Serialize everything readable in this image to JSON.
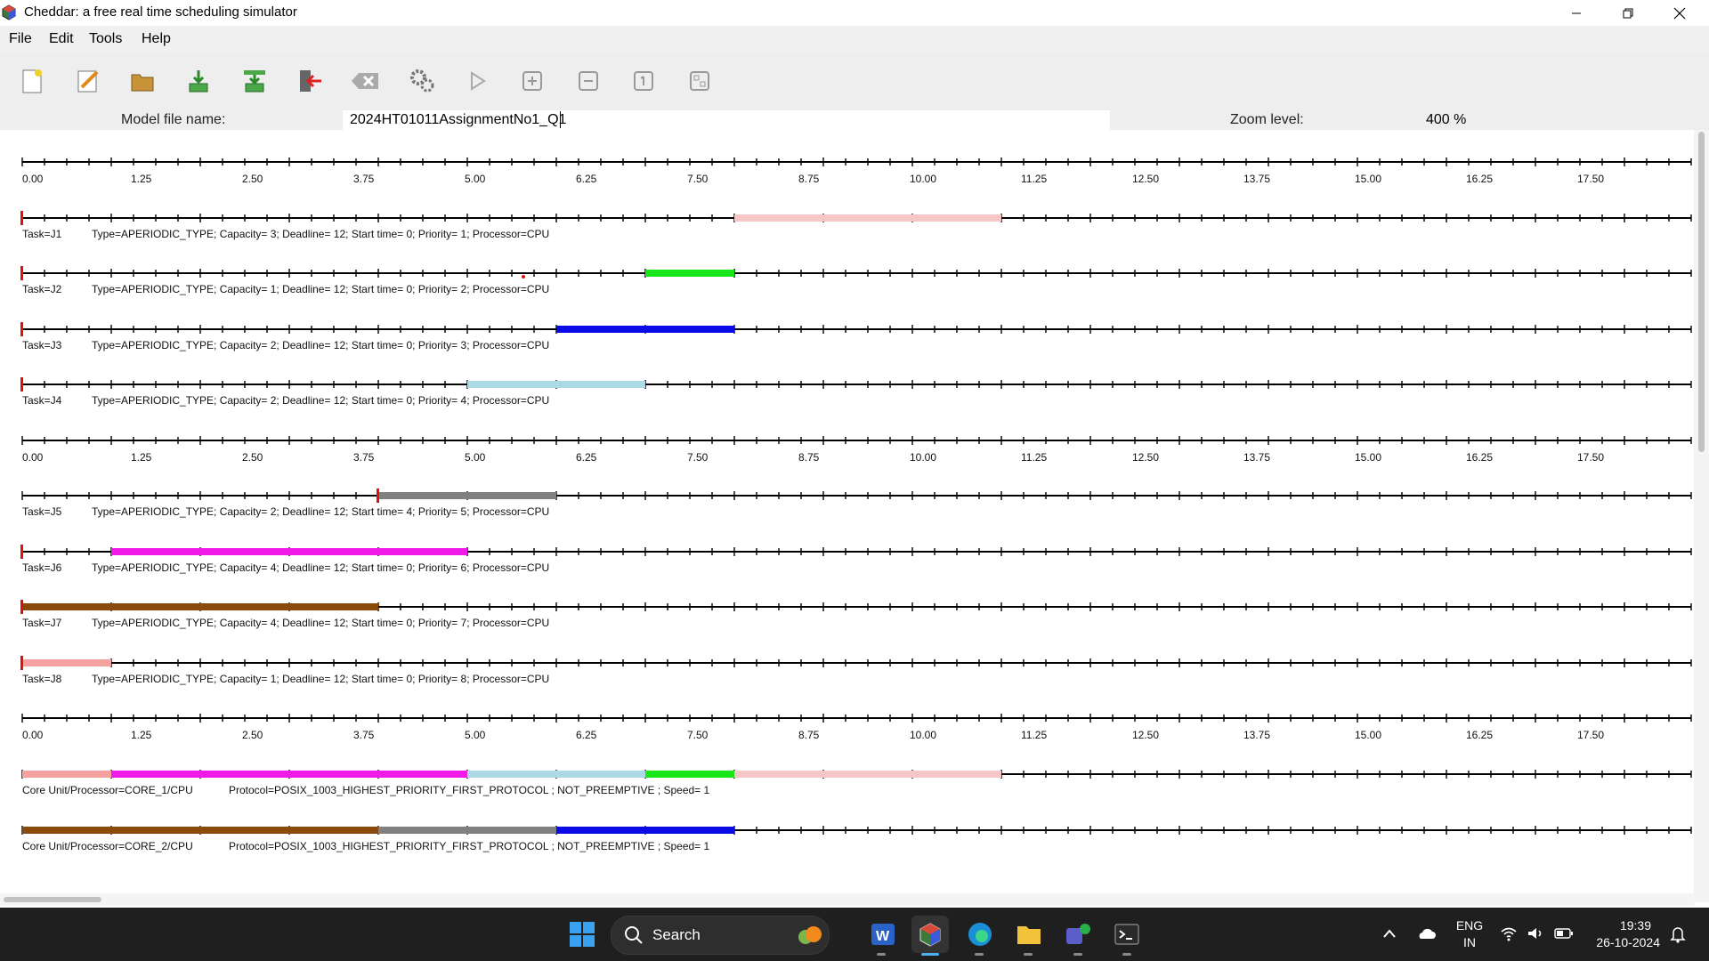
{
  "window": {
    "title": "Cheddar: a free real time scheduling simulator",
    "controls": [
      "minimize",
      "restore",
      "close"
    ]
  },
  "menu": [
    "File",
    "Edit",
    "Tools",
    "Help"
  ],
  "toolbar": {
    "icons": [
      "new-file-icon",
      "edit-icon",
      "open-folder-icon",
      "save-icon",
      "export-icon",
      "exit-icon",
      "clear-icon",
      "settings-icon",
      "play-icon",
      "zoom-in-icon",
      "zoom-out-icon",
      "zoom-reset-icon",
      "fit-icon"
    ]
  },
  "file_info": {
    "model_label": "Model file name:",
    "model_value": "2024HT01011AssignmentNo1_Q1",
    "zoom_label": "Zoom level:",
    "zoom_value": "400 %"
  },
  "gantt": {
    "tick_labels": [
      "0.00",
      "1.25",
      "2.50",
      "3.75",
      "5.00",
      "6.25",
      "7.50",
      "8.75",
      "10.00",
      "11.25",
      "12.50",
      "13.75",
      "15.00",
      "16.25",
      "17.50"
    ],
    "tasks": [
      {
        "name": "Task=J1",
        "details": "Type=APERIODIC_TYPE; Capacity= 3; Deadline= 12; Start time= 0; Priority= 1; Processor=CPU",
        "release": 0,
        "color": "#f7c6c6",
        "segments": [
          [
            8,
            11
          ]
        ]
      },
      {
        "name": "Task=J2",
        "details": "Type=APERIODIC_TYPE; Capacity= 1; Deadline= 12; Start time= 0; Priority= 2; Processor=CPU",
        "release": 0,
        "color": "#19e619",
        "segments": [
          [
            7,
            8
          ]
        ]
      },
      {
        "name": "Task=J3",
        "details": "Type=APERIODIC_TYPE; Capacity= 2; Deadline= 12; Start time= 0; Priority= 3; Processor=CPU",
        "release": 0,
        "color": "#0a0ae6",
        "segments": [
          [
            6,
            8
          ]
        ]
      },
      {
        "name": "Task=J4",
        "details": "Type=APERIODIC_TYPE; Capacity= 2; Deadline= 12; Start time= 0; Priority= 4; Processor=CPU",
        "release": 0,
        "color": "#add8e6",
        "segments": [
          [
            5,
            7
          ]
        ]
      },
      {
        "name": "Task=J5",
        "details": "Type=APERIODIC_TYPE; Capacity= 2; Deadline= 12; Start time= 4; Priority= 5; Processor=CPU",
        "release": 4,
        "color": "#808080",
        "segments": [
          [
            4,
            6
          ]
        ]
      },
      {
        "name": "Task=J6",
        "details": "Type=APERIODIC_TYPE; Capacity= 4; Deadline= 12; Start time= 0; Priority= 6; Processor=CPU",
        "release": 0,
        "color": "#f01ae8",
        "segments": [
          [
            1,
            5
          ]
        ]
      },
      {
        "name": "Task=J7",
        "details": "Type=APERIODIC_TYPE; Capacity= 4; Deadline= 12; Start time= 0; Priority= 7; Processor=CPU",
        "release": 0,
        "color": "#8c4a0a",
        "segments": [
          [
            0,
            4
          ]
        ]
      },
      {
        "name": "Task=J8",
        "details": "Type=APERIODIC_TYPE; Capacity= 1; Deadline= 12; Start time= 0; Priority= 8; Processor=CPU",
        "release": 0,
        "color": "#f7a0a0",
        "segments": [
          [
            0,
            1
          ]
        ]
      }
    ],
    "cores": [
      {
        "name": "Core Unit/Processor=CORE_1/CPU",
        "details": "Protocol=POSIX_1003_HIGHEST_PRIORITY_FIRST_PROTOCOL ; NOT_PREEMPTIVE ; Speed= 1",
        "segments": [
          [
            0,
            1,
            "#f7a0a0"
          ],
          [
            1,
            5,
            "#f01ae8"
          ],
          [
            5,
            7,
            "#add8e6"
          ],
          [
            7,
            8,
            "#19e619"
          ],
          [
            8,
            11,
            "#f7c6c6"
          ]
        ]
      },
      {
        "name": "Core Unit/Processor=CORE_2/CPU",
        "details": "Protocol=POSIX_1003_HIGHEST_PRIORITY_FIRST_PROTOCOL ; NOT_PREEMPTIVE ; Speed= 1",
        "segments": [
          [
            0,
            4,
            "#8c4a0a"
          ],
          [
            4,
            6,
            "#808080"
          ],
          [
            6,
            8,
            "#0a0ae6"
          ]
        ]
      }
    ]
  },
  "taskbar": {
    "search_placeholder": "Search",
    "language": "ENG",
    "region": "IN",
    "time": "19:39",
    "date": "26-10-2024"
  }
}
